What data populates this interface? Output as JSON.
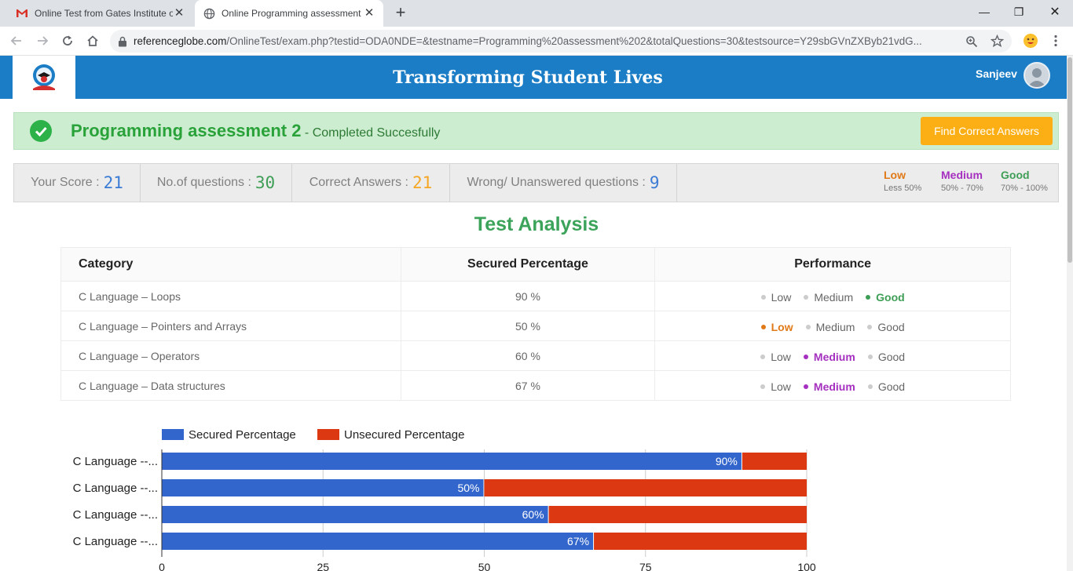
{
  "browser": {
    "tabs": [
      {
        "title": "Online Test from Gates Institute o",
        "icon": "gmail-icon",
        "close": "✕"
      },
      {
        "title": "Online Programming assessment",
        "icon": "globe-icon",
        "close": "✕"
      }
    ],
    "new_tab": "+",
    "url_host": "referenceglobe.com",
    "url_path": "/OnlineTest/exam.php?testid=ODA0NDE=&testname=Programming%20assessment%202&totalQuestions=30&testsource=Y29sbGVnZXByb21vdG...",
    "window_controls": {
      "minimize": "—",
      "restore": "❐",
      "close": "✕"
    }
  },
  "header": {
    "site_title": "Transforming Student Lives",
    "user_name": "Sanjeev",
    "brand_color": "#1a7dc6"
  },
  "banner": {
    "test_name": "Programming assessment 2",
    "status": " - Completed Succesfully",
    "find_button": "Find Correct Answers"
  },
  "score": {
    "your_score_label": "Your Score :",
    "your_score": "21",
    "questions_label": "No.of questions :",
    "questions": "30",
    "correct_label": "Correct Answers :",
    "correct": "21",
    "wrong_label": "Wrong/ Unanswered questions :",
    "wrong": "9",
    "legend": [
      {
        "label": "Low",
        "range": "Less 50%",
        "color": "#e07a18"
      },
      {
        "label": "Medium",
        "range": "50% - 70%",
        "color": "#a52fbf"
      },
      {
        "label": "Good",
        "range": "70% - 100%",
        "color": "#3e9e56"
      }
    ]
  },
  "analysis": {
    "title": "Test Analysis",
    "headers": [
      "Category",
      "Secured Percentage",
      "Performance"
    ],
    "perf_labels": [
      "Low",
      "Medium",
      "Good"
    ],
    "rows": [
      {
        "category": "C Language – Loops",
        "percentage": "90 %",
        "level": "Good"
      },
      {
        "category": "C Language – Pointers and Arrays",
        "percentage": "50 %",
        "level": "Low"
      },
      {
        "category": "C Language – Operators",
        "percentage": "60 %",
        "level": "Medium"
      },
      {
        "category": "C Language – Data structures",
        "percentage": "67 %",
        "level": "Medium"
      }
    ]
  },
  "chart_data": {
    "type": "bar",
    "orientation": "horizontal",
    "stacked": true,
    "categories": [
      "C Language --...",
      "C Language --...",
      "C Language --...",
      "C Language --..."
    ],
    "series": [
      {
        "name": "Secured Percentage",
        "values": [
          90,
          50,
          60,
          67
        ],
        "color": "#3366cc",
        "labels": [
          "90%",
          "50%",
          "60%",
          "67%"
        ]
      },
      {
        "name": "Unsecured Percentage",
        "values": [
          10,
          50,
          40,
          33
        ],
        "color": "#dc3912"
      }
    ],
    "xlim": [
      0,
      100
    ],
    "xticks": [
      "0",
      "25",
      "50",
      "75",
      "100"
    ],
    "grid": true,
    "legend_position": "top"
  }
}
